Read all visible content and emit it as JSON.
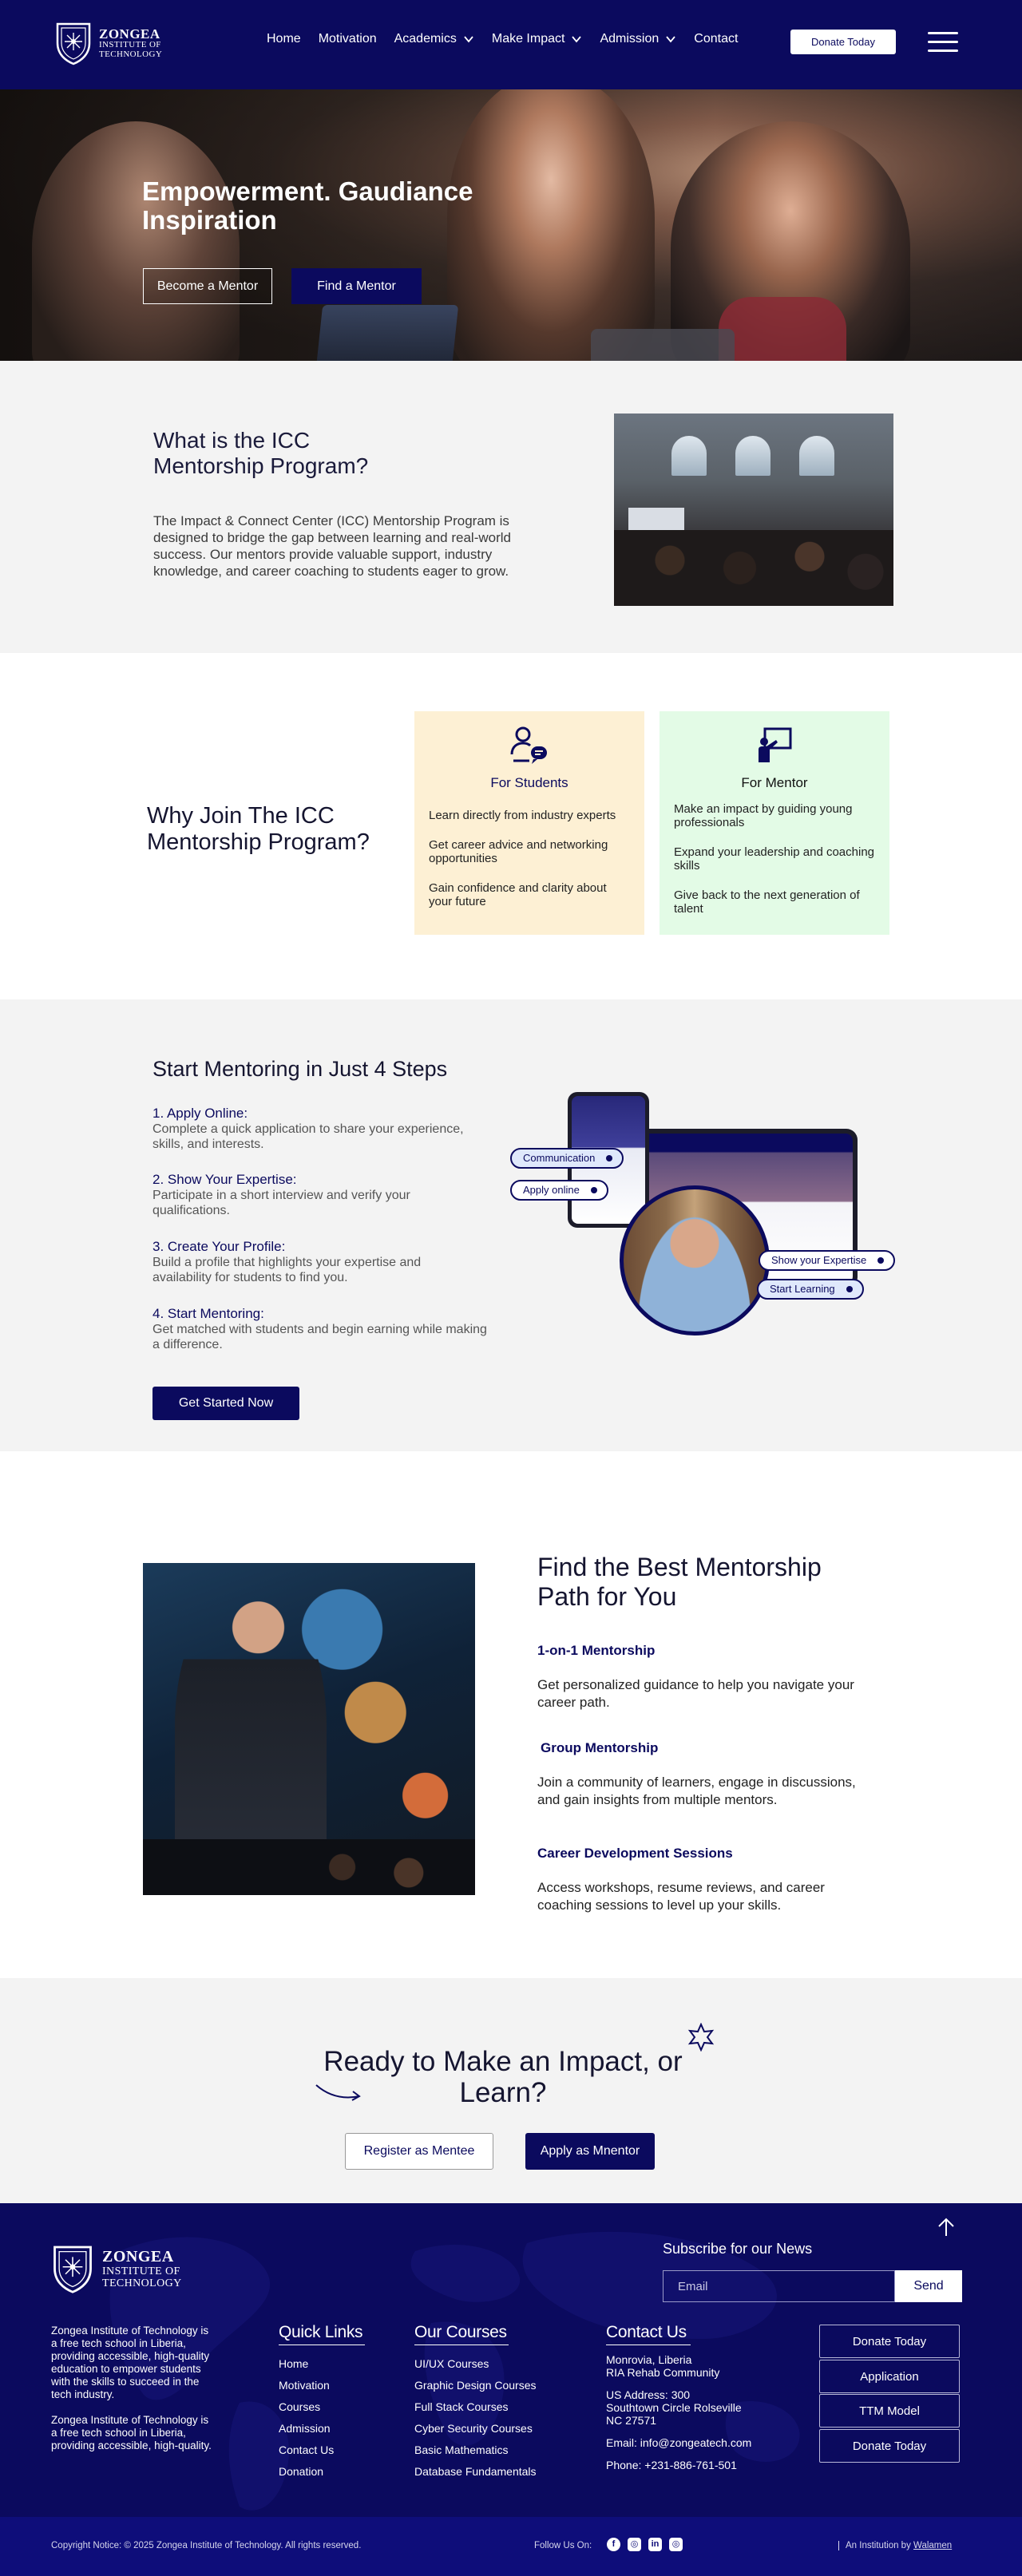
{
  "header": {
    "logo": {
      "line1": "ZONGEA",
      "line2": "INSTITUTE OF",
      "line3": "TECHNOLOGY"
    },
    "nav": [
      {
        "label": "Home",
        "dropdown": false
      },
      {
        "label": "Motivation",
        "dropdown": false
      },
      {
        "label": "Academics",
        "dropdown": true
      },
      {
        "label": "Make Impact",
        "dropdown": true
      },
      {
        "label": "Admission",
        "dropdown": true
      },
      {
        "label": "Contact",
        "dropdown": false
      }
    ],
    "donate_label": "Donate Today",
    "menu_icon": "hamburger-icon"
  },
  "hero": {
    "title": "Empowerment. Gaudiance Inspiration",
    "become_mentor": "Become a Mentor",
    "find_mentor": "Find a Mentor"
  },
  "what_is": {
    "title": "What is the ICC Mentorship Program?",
    "body": "The Impact & Connect Center (ICC) Mentorship Program is designed to bridge the gap between learning and real-world success. Our mentors provide valuable support, industry knowledge, and career coaching to students eager to grow."
  },
  "why_join": {
    "title": "Why Join The ICC Mentorship Program?",
    "students": {
      "title": "For Students",
      "icon": "students-chat-icon",
      "items": [
        "Learn directly from industry experts",
        "Get career advice and networking opportunities",
        "Gain confidence and clarity about your future"
      ]
    },
    "mentor": {
      "title": "For Mentor",
      "icon": "mentor-board-icon",
      "items": [
        "Make an impact by guiding young professionals",
        "Expand your leadership and coaching skills",
        "Give back to the next generation of talent"
      ]
    }
  },
  "steps": {
    "title": "Start Mentoring in Just 4 Steps",
    "items": [
      {
        "title": "1. Apply Online:",
        "desc": "Complete a quick application to share your experience, skills, and interests."
      },
      {
        "title": "2. Show Your Expertise:",
        "desc": "Participate in a short interview and verify your qualifications."
      },
      {
        "title": "3. Create Your Profile:",
        "desc": "Build a profile that highlights your expertise and availability for students to find you."
      },
      {
        "title": "4. Start Mentoring:",
        "desc": "Get matched with students and begin earning while making a difference."
      }
    ],
    "cta": "Get Started Now",
    "pills": {
      "communication": "Communication",
      "apply_online": "Apply online",
      "show_expertise": "Show your Expertise",
      "start_learning": "Start Learning"
    }
  },
  "best_path": {
    "title": "Find the Best Mentorship Path for You",
    "options": [
      {
        "title": "1-on-1 Mentorship",
        "desc": "Get personalized guidance to help you navigate your career path."
      },
      {
        "title": "Group Mentorship",
        "desc": "Join a community of learners, engage in discussions, and gain insights from multiple mentors."
      },
      {
        "title": "Career Development Sessions",
        "desc": "Access workshops, resume reviews, and career coaching sessions to level up your skills."
      }
    ]
  },
  "cta": {
    "title": "Ready to Make an Impact, or Learn?",
    "mentee": "Register as Mentee",
    "mentor": "Apply as Mnentor"
  },
  "footer": {
    "logo": {
      "line1": "ZONGEA",
      "line2": "INSTITUTE OF",
      "line3": "TECHNOLOGY"
    },
    "about": [
      "Zongea Institute of Technology is a free tech school in Liberia, providing accessible, high-quality education to empower students with the skills to succeed in the tech industry.",
      "Zongea Institute of Technology is a free tech school in Liberia, providing accessible, high-quality."
    ],
    "quick_links": {
      "title": "Quick Links",
      "items": [
        "Home",
        "Motivation",
        "Courses",
        "Admission",
        "Contact Us",
        "Donation"
      ]
    },
    "courses": {
      "title": "Our Courses",
      "items": [
        "UI/UX Courses",
        "Graphic Design Courses",
        "Full Stack Courses",
        "Cyber Security Courses",
        "Basic Mathematics",
        "Database Fundamentals"
      ]
    },
    "contact": {
      "title": "Contact Us",
      "lines": [
        "Monrovia, Liberia\nRIA Rehab Community",
        "US Address: 300\nSouthtown Circle Rolseville\nNC 27571",
        "Email: info@zongeatech.com",
        "Phone: +231-886-761-501"
      ]
    },
    "newsletter": {
      "title": "Subscribe for our News",
      "placeholder": "Email",
      "send": "Send"
    },
    "buttons": [
      "Donate Today",
      "Application",
      "TTM Model",
      "Donate Today"
    ]
  },
  "bottom": {
    "copyright": "Copyright Notice: © 2025 Zongea Institute of Technology. All rights reserved.",
    "follow": "Follow Us On:",
    "socials": [
      "facebook-icon",
      "instagram-icon",
      "linkedin-icon",
      "instagram-icon"
    ],
    "institution_prefix": "An Institution by",
    "institution_link": "Walamen"
  },
  "colors": {
    "brand_navy": "#0b0a5e",
    "students_card": "#fdf0d4",
    "mentor_card": "#e3fbe6",
    "section_gray": "#f3f3f3"
  }
}
